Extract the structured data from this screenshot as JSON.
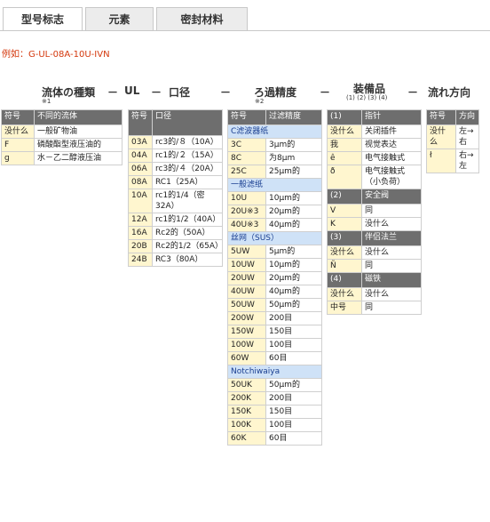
{
  "tabs": [
    "型号标志",
    "元素",
    "密封材料"
  ],
  "example": "例如：G-UL-08A-10U-IVN",
  "headers": {
    "fluid": "流体の種類",
    "sep1": "－",
    "ul": "UL",
    "sep2": "－",
    "port": "口径",
    "sep3": "－",
    "filtration": "ろ過精度",
    "sep4": "－",
    "equipment": "装備品",
    "equipment_sub": "(1) (2) (3) (4)",
    "sep5": "－",
    "flow": "流れ方向",
    "note1": "※1",
    "note2": "※2"
  },
  "fluid": {
    "cols": [
      "符号",
      "不同的流体"
    ],
    "rows": [
      [
        "没什么",
        "一般矿物油"
      ],
      [
        "F",
        "磷酸酯型液压油的"
      ],
      [
        "ɡ",
        "水－乙二醇液压油"
      ]
    ]
  },
  "port": {
    "cols": [
      "符号",
      "口径"
    ],
    "rows": [
      [
        "03A",
        "rc3的/８（10A）"
      ],
      [
        "04A",
        "rc1的/２（15A）"
      ],
      [
        "06A",
        "rc3的/４（20A）"
      ],
      [
        "08A",
        "RC1（25A）"
      ],
      [
        "10A",
        "rc1的1/4（密32A）"
      ],
      [
        "12A",
        "rc1的1/2（40A）"
      ],
      [
        "16A",
        "Rc2的（50A）"
      ],
      [
        "20B",
        "Rc2的1/2（65A）"
      ],
      [
        "24B",
        "RC3（80A）"
      ]
    ]
  },
  "filter": {
    "cols": [
      "符号",
      "过滤精度"
    ],
    "groups": [
      {
        "title": "C滤波器纸",
        "rows": [
          [
            "3C",
            "3μm的"
          ],
          [
            "8C",
            "为8μm"
          ],
          [
            "25C",
            "25μm的"
          ]
        ]
      },
      {
        "title": "一般滤纸",
        "rows": [
          [
            "10U",
            "10μm的"
          ],
          [
            "20U※3",
            "20μm的"
          ],
          [
            "40U※3",
            "40μm的"
          ]
        ]
      },
      {
        "title": "丝网（SUS）",
        "rows": [
          [
            "5UW",
            "5μm的"
          ],
          [
            "10UW",
            "10μm的"
          ],
          [
            "20UW",
            "20μm的"
          ],
          [
            "40UW",
            "40μm的"
          ],
          [
            "50UW",
            "50μm的"
          ],
          [
            "200W",
            "200目"
          ],
          [
            "150W",
            "150目"
          ],
          [
            "100W",
            "100目"
          ],
          [
            "60W",
            "60目"
          ]
        ]
      },
      {
        "title": "Notchiwaiya",
        "rows": [
          [
            "50UK",
            "50μm的"
          ],
          [
            "200K",
            "200目"
          ],
          [
            "150K",
            "150目"
          ],
          [
            "100K",
            "100目"
          ],
          [
            "60K",
            "60目"
          ]
        ]
      }
    ]
  },
  "equip": [
    {
      "num": "(1)",
      "title": "指针",
      "rows": [
        [
          "没什么",
          "关闭插件"
        ],
        [
          "我",
          "视觉表达"
        ],
        [
          "ê",
          "电气接触式"
        ],
        [
          "ð",
          "电气接触式（小负荷）"
        ]
      ]
    },
    {
      "num": "(2)",
      "title": "安全阀",
      "rows": [
        [
          "V",
          "同"
        ],
        [
          "K",
          "没什么"
        ]
      ]
    },
    {
      "num": "(3)",
      "title": "伴侣法兰",
      "rows": [
        [
          "没什么",
          "没什么"
        ],
        [
          "Ñ",
          "同"
        ]
      ]
    },
    {
      "num": "(4)",
      "title": "磁铁",
      "rows": [
        [
          "没什么",
          "没什么"
        ],
        [
          "中号",
          "同"
        ]
      ]
    }
  ],
  "flow": {
    "cols": [
      "符号",
      "方向"
    ],
    "rows": [
      [
        "没什么",
        "左→右"
      ],
      [
        "ł",
        "右→左"
      ]
    ]
  }
}
